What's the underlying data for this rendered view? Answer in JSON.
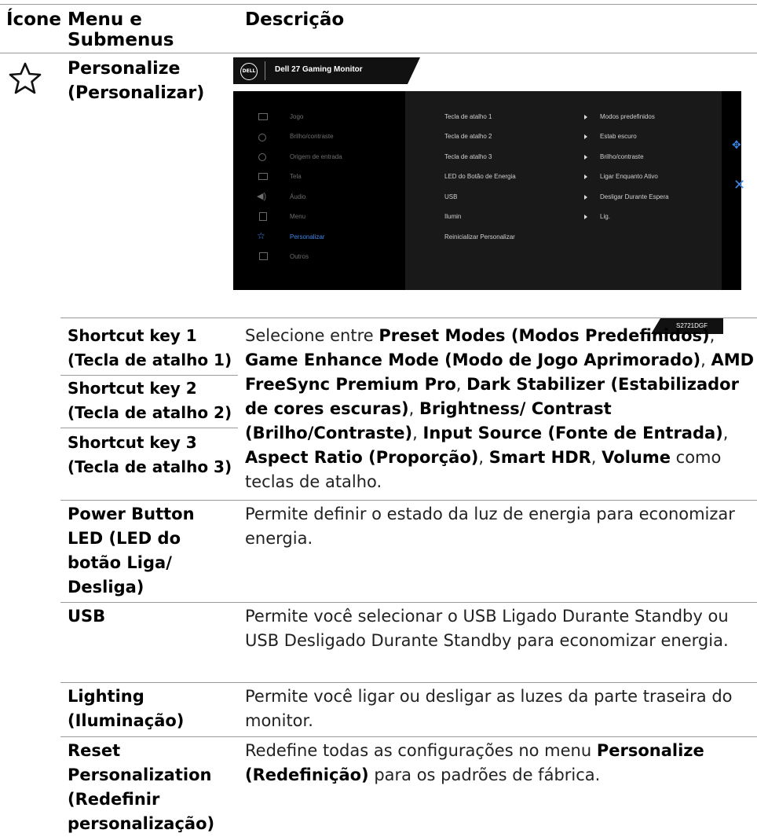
{
  "headers": {
    "icon": "Ícone",
    "menu": "Menu e Submenus",
    "description": "Descrição"
  },
  "section": {
    "icon": "star-icon",
    "title": "Personalize (Personalizar)"
  },
  "osd": {
    "brand": "DELL",
    "title": "Dell 27 Gaming Monitor",
    "menu_items": [
      {
        "label": "Jogo",
        "icon": "game-icon"
      },
      {
        "label": "Brilho/contraste",
        "icon": "brightness-icon"
      },
      {
        "label": "Origem de entrada",
        "icon": "input-icon"
      },
      {
        "label": "Tela",
        "icon": "display-icon"
      },
      {
        "label": "Áudio",
        "icon": "audio-icon"
      },
      {
        "label": "Menu",
        "icon": "menu-icon"
      },
      {
        "label": "Personalizar",
        "icon": "star-icon",
        "active": true
      },
      {
        "label": "Outros",
        "icon": "others-icon"
      }
    ],
    "submenu": [
      {
        "label": "Tecla de atalho 1",
        "value": "Modos predefinidos"
      },
      {
        "label": "Tecla de atalho 2",
        "value": "Estab escuro"
      },
      {
        "label": "Tecla de atalho 3",
        "value": "Brilho/contraste"
      },
      {
        "label": "LED do Botão de Energia",
        "value": "Ligar Enquanto Ativo"
      },
      {
        "label": "USB",
        "value": "Desligar Durante Espera"
      },
      {
        "label": "Ilumin",
        "value": "Lig."
      },
      {
        "label": "Reinicializar Personalizar",
        "value": ""
      }
    ],
    "model": "S2721DGF",
    "accent": "#3b86e6"
  },
  "rows": {
    "shortcut1": "Shortcut key 1 (Tecla de atalho 1)",
    "shortcut2": "Shortcut key 2 (Tecla de atalho 2)",
    "shortcut3": "Shortcut key 3 (Tecla de atalho 3)",
    "shortcut_desc": [
      {
        "t": "Selecione entre ",
        "b": false
      },
      {
        "t": "Preset Modes (Modos Predefinidos)",
        "b": true
      },
      {
        "t": ", ",
        "b": false
      },
      {
        "t": "Game Enhance Mode (Modo de Jogo Aprimorado)",
        "b": true
      },
      {
        "t": ", ",
        "b": false
      },
      {
        "t": "AMD FreeSync Premium Pro",
        "b": true
      },
      {
        "t": ", ",
        "b": false
      },
      {
        "t": "Dark Stabilizer (Estabilizador de cores escuras)",
        "b": true
      },
      {
        "t": ", ",
        "b": false
      },
      {
        "t": "Brightness/ Contrast (Brilho/Contraste)",
        "b": true
      },
      {
        "t": ", ",
        "b": false
      },
      {
        "t": "Input Source (Fonte de Entrada)",
        "b": true
      },
      {
        "t": ", ",
        "b": false
      },
      {
        "t": "Aspect Ratio (Proporção)",
        "b": true
      },
      {
        "t": ", ",
        "b": false
      },
      {
        "t": "Smart HDR",
        "b": true
      },
      {
        "t": ", ",
        "b": false
      },
      {
        "t": "Volume",
        "b": true
      },
      {
        "t": " como teclas de atalho.",
        "b": false
      }
    ],
    "power_led": "Power Button LED (LED do botão Liga/ Desliga)",
    "power_led_desc": "Permite definir o estado da luz de energia para economizar energia.",
    "usb": "USB",
    "usb_desc": "Permite você selecionar o USB Ligado Durante Standby ou USB Desligado Durante Standby para economizar energia.",
    "lighting": "Lighting (Iluminação)",
    "lighting_desc": "Permite você ligar ou desligar as luzes da parte traseira do monitor.",
    "reset": "Reset Personalization (Redefinir personalização)",
    "reset_desc": [
      {
        "t": "Redefine todas as configurações no menu ",
        "b": false
      },
      {
        "t": "Personalize (Redefinição)",
        "b": true
      },
      {
        "t": " para os padrões de fábrica.",
        "b": false
      }
    ]
  }
}
